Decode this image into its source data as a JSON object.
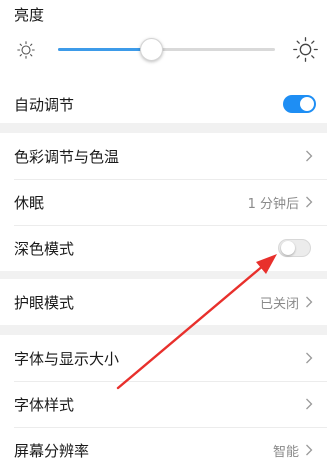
{
  "brightness": {
    "title": "亮度",
    "level": 0.43,
    "auto_label": "自动调节",
    "auto_on": true
  },
  "display_group": {
    "color": {
      "label": "色彩调节与色温"
    },
    "sleep": {
      "label": "休眠",
      "value": "1 分钟后"
    },
    "dark_mode": {
      "label": "深色模式",
      "on": false
    }
  },
  "eye_care": {
    "label": "护眼模式",
    "value": "已关闭"
  },
  "font_group": {
    "font_size": {
      "label": "字体与显示大小"
    },
    "font_style": {
      "label": "字体样式"
    },
    "resolution": {
      "label": "屏幕分辨率",
      "value": "智能"
    }
  },
  "colors": {
    "accent": "#1e8ef4",
    "slider": "#3d9be9",
    "annotation_arrow": "#e8302c"
  },
  "icons": [
    "sun-dim-icon",
    "sun-bright-icon",
    "chevron-right-icon",
    "red-arrow-annotation"
  ]
}
